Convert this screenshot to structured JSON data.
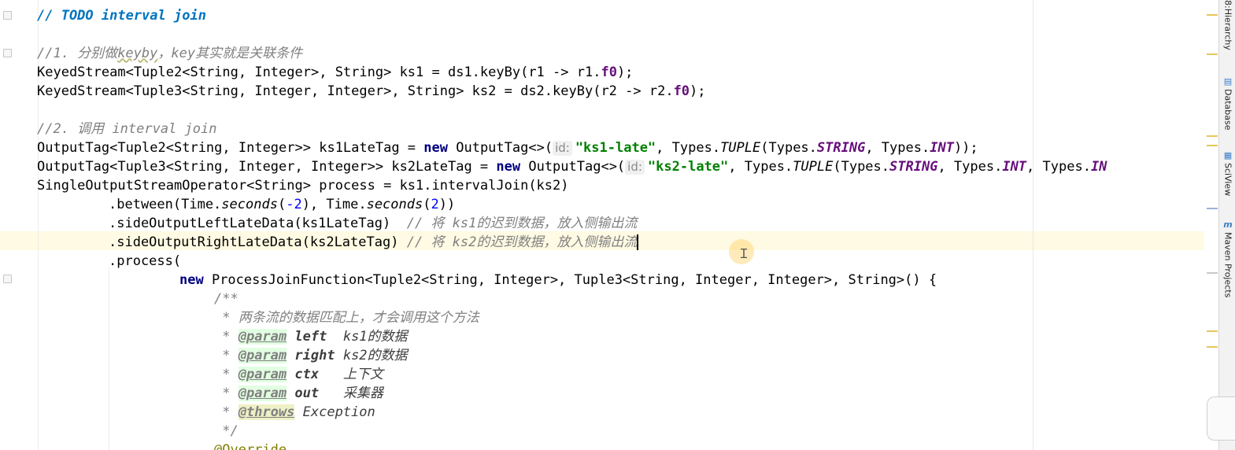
{
  "editor": {
    "comment_todo": "// TODO interval join",
    "comment_step1_prefix": "//1. 分别做",
    "comment_step1_keyby": "keyby",
    "comment_step1_suffix": "，key其实就是关联条件",
    "ks1_decl": "KeyedStream<Tuple2<String, Integer>, String> ks1 = ds1.keyBy(r1 -> r1.",
    "ks1_field": "f0",
    "ks1_end": ");",
    "ks2_decl": "KeyedStream<Tuple3<String, Integer, Integer>, String> ks2 = ds2.keyBy(r2 -> r2.",
    "ks2_field": "f0",
    "ks2_end": ");",
    "comment_step2": "//2. 调用 interval join",
    "tag1_start": "OutputTag<Tuple2<String, Integer>> ks1LateTag = ",
    "kw_new": "new",
    "tag_ctor": " OutputTag<>(",
    "hint_id": "id:",
    "tag1_str": "\"ks1-late\"",
    "tag1_types": ", Types.",
    "tuple": "TUPLE",
    "paren_types": "(Types.",
    "string_const": "STRING",
    "comma_types": ", Types.",
    "int_const": "INT",
    "tag1_end": "));",
    "tag2_start": "OutputTag<Tuple3<String, Integer, Integer>> ks2LateTag = ",
    "tag2_str": "\"ks2-late\"",
    "tag2_tail_types": ", Types.",
    "tag2_tail_in": "IN",
    "process_decl": "SingleOutputStreamOperator<String> process = ks1.intervalJoin(ks2)",
    "between_start": ".between(Time.",
    "seconds": "seconds",
    "neg_two": "-2",
    "between_mid": "), Time.",
    "pos_two": "2",
    "between_end": "))",
    "side_left": ".sideOutputLeftLateData(ks1LateTag)",
    "side_left_comment": "// 将 ks1的迟到数据，放入侧输出流",
    "side_right": ".sideOutputRightLateData(ks2LateTag)",
    "side_right_comment": "// 将 ks2的迟到数据，放入侧输出流",
    "process_call": ".process(",
    "pjf_rest": " ProcessJoinFunction<Tuple2<String, Integer>, Tuple3<String, Integer, Integer>, String>() {",
    "doc_open": "/**",
    "doc_desc": " * 两条流的数据匹配上，才会调用这个方法",
    "doc_star": " * ",
    "param_tag": "@param",
    "param_left": "left",
    "param_left_desc": "ks1的数据",
    "param_right": "right",
    "param_right_desc": "ks2的数据",
    "param_ctx": "ctx",
    "param_ctx_desc": "上下文",
    "param_out": "out",
    "param_out_desc": "采集器",
    "throws_tag": "@throws",
    "throws_exc": "Exception",
    "doc_close": " */",
    "override": "@Override"
  },
  "tool_windows": [
    {
      "label": "Hierarchy",
      "icon": "hierarchy-icon",
      "number": "8:"
    },
    {
      "label": "Database",
      "icon": "database-icon"
    },
    {
      "label": "SciView",
      "icon": "sciview-icon"
    },
    {
      "label": "Maven Projects",
      "icon": "maven-icon",
      "glyph": "m"
    }
  ],
  "colors": {
    "keyword": "#000080",
    "string": "#008000",
    "comment": "#808080",
    "todo": "#0073bf",
    "field": "#660e7a",
    "number": "#0000ff",
    "current_line": "#fffae3"
  }
}
